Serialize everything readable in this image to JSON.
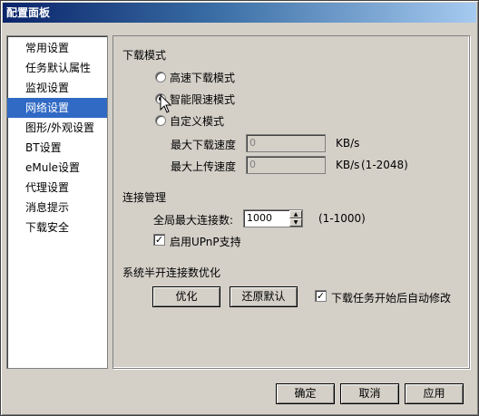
{
  "window": {
    "title": "配置面板"
  },
  "sidebar": {
    "items": [
      {
        "label": "常用设置"
      },
      {
        "label": "任务默认属性"
      },
      {
        "label": "监视设置"
      },
      {
        "label": "网络设置",
        "selected": true
      },
      {
        "label": "图形/外观设置"
      },
      {
        "label": "BT设置"
      },
      {
        "label": "eMule设置"
      },
      {
        "label": "代理设置"
      },
      {
        "label": "消息提示"
      },
      {
        "label": "下载安全"
      }
    ]
  },
  "download_mode": {
    "heading": "下载模式",
    "options": [
      {
        "label": "高速下载模式",
        "selected": false
      },
      {
        "label": "智能限速模式",
        "selected": true
      },
      {
        "label": "自定义模式",
        "selected": false
      }
    ],
    "max_download": {
      "label": "最大下载速度",
      "value": "0",
      "unit": "KB/s"
    },
    "max_upload": {
      "label": "最大上传速度",
      "value": "0",
      "unit": "KB/s",
      "range": "(1-2048)"
    }
  },
  "connection": {
    "heading": "连接管理",
    "max_conn_label": "全局最大连接数:",
    "max_conn_value": "1000",
    "max_conn_range": "(1-1000)",
    "upnp_label": "启用UPnP支持",
    "upnp_checked": true
  },
  "half_open": {
    "heading": "系统半开连接数优化",
    "optimize_btn": "优化",
    "restore_btn": "还原默认",
    "auto_modify_label": "下载任务开始后自动修改",
    "auto_modify_checked": true
  },
  "footer": {
    "ok": "确定",
    "cancel": "取消",
    "apply": "应用"
  },
  "colors": {
    "selection": "#316ac5",
    "face": "#d4d0c8",
    "title_start": "#0a246a"
  }
}
